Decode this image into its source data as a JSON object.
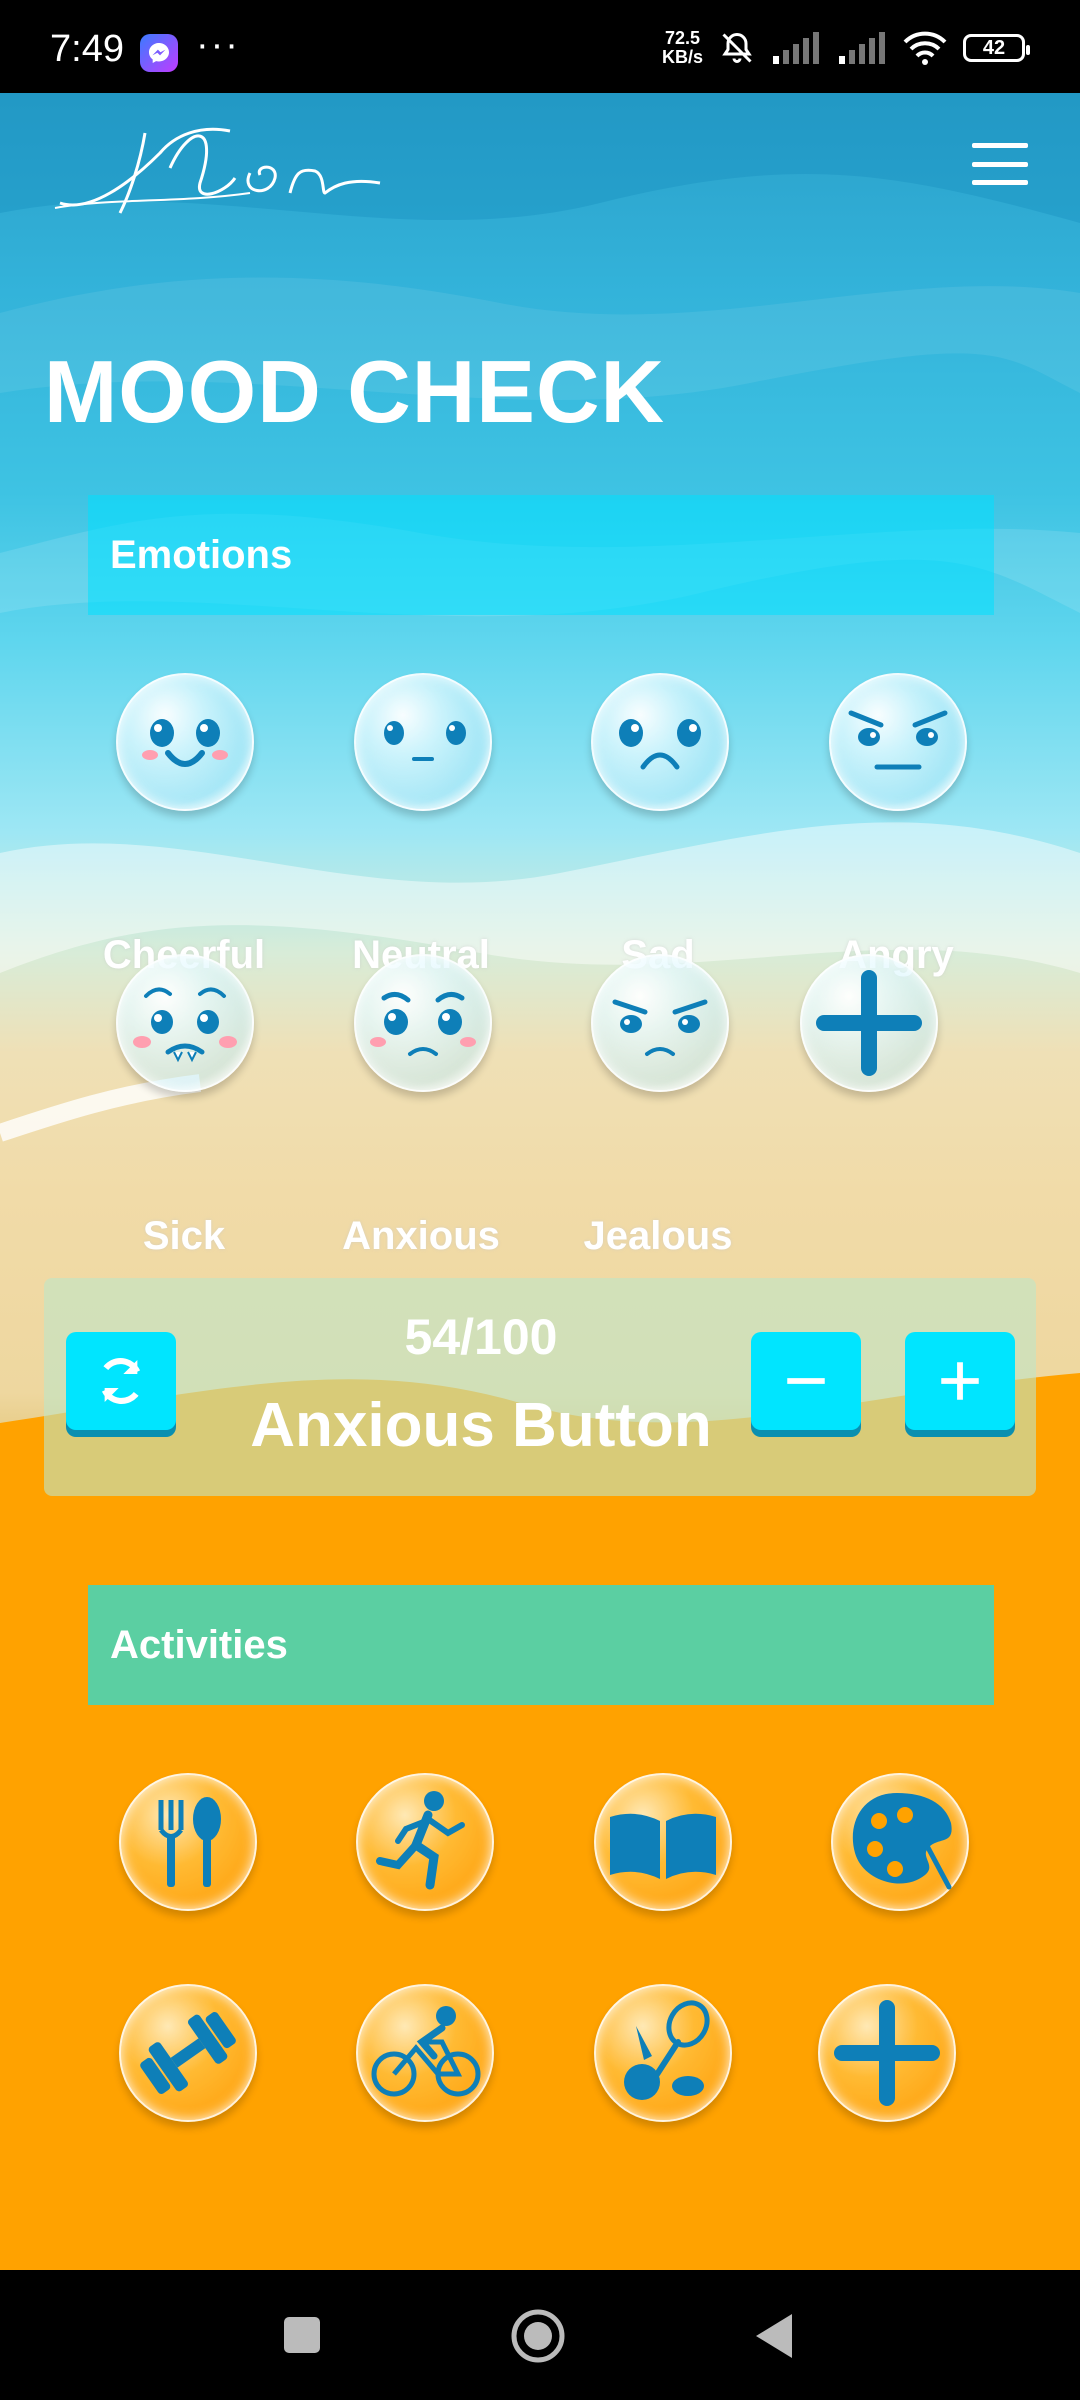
{
  "status_bar": {
    "time": "7:49",
    "speed_value": "72.5",
    "speed_unit": "KB/s",
    "battery": "42"
  },
  "header": {
    "logo_text": "Elon",
    "menu_icon": "hamburger-menu-icon"
  },
  "page": {
    "title": "MOOD CHECK"
  },
  "emotions": {
    "header": "Emotions",
    "items": [
      {
        "label": "Cheerful",
        "icon": "cheerful-face-icon"
      },
      {
        "label": "Neutral",
        "icon": "neutral-face-icon"
      },
      {
        "label": "Sad",
        "icon": "sad-face-icon"
      },
      {
        "label": "Angry",
        "icon": "angry-face-icon"
      },
      {
        "label": "Sick",
        "icon": "sick-face-icon"
      },
      {
        "label": "Anxious",
        "icon": "anxious-face-icon"
      },
      {
        "label": "Jealous",
        "icon": "jealous-face-icon"
      },
      {
        "label": "",
        "icon": "add-icon"
      }
    ]
  },
  "counter": {
    "value": "54/100",
    "label": "Anxious Button",
    "reset_icon": "refresh-icon",
    "decrement_icon": "minus-icon",
    "increment_icon": "plus-icon"
  },
  "activities": {
    "header": "Activities",
    "items": [
      {
        "icon": "fork-spoon-icon"
      },
      {
        "icon": "running-icon"
      },
      {
        "icon": "book-icon"
      },
      {
        "icon": "palette-icon"
      },
      {
        "icon": "dumbbell-icon"
      },
      {
        "icon": "cycling-icon"
      },
      {
        "icon": "sports-icon"
      },
      {
        "icon": "add-icon"
      }
    ]
  },
  "colors": {
    "accent_cyan": "#00e5ff",
    "icon_blue": "#0e7fb8",
    "activities_header": "#5bcfa2",
    "sand_orange": "#ffa200"
  }
}
